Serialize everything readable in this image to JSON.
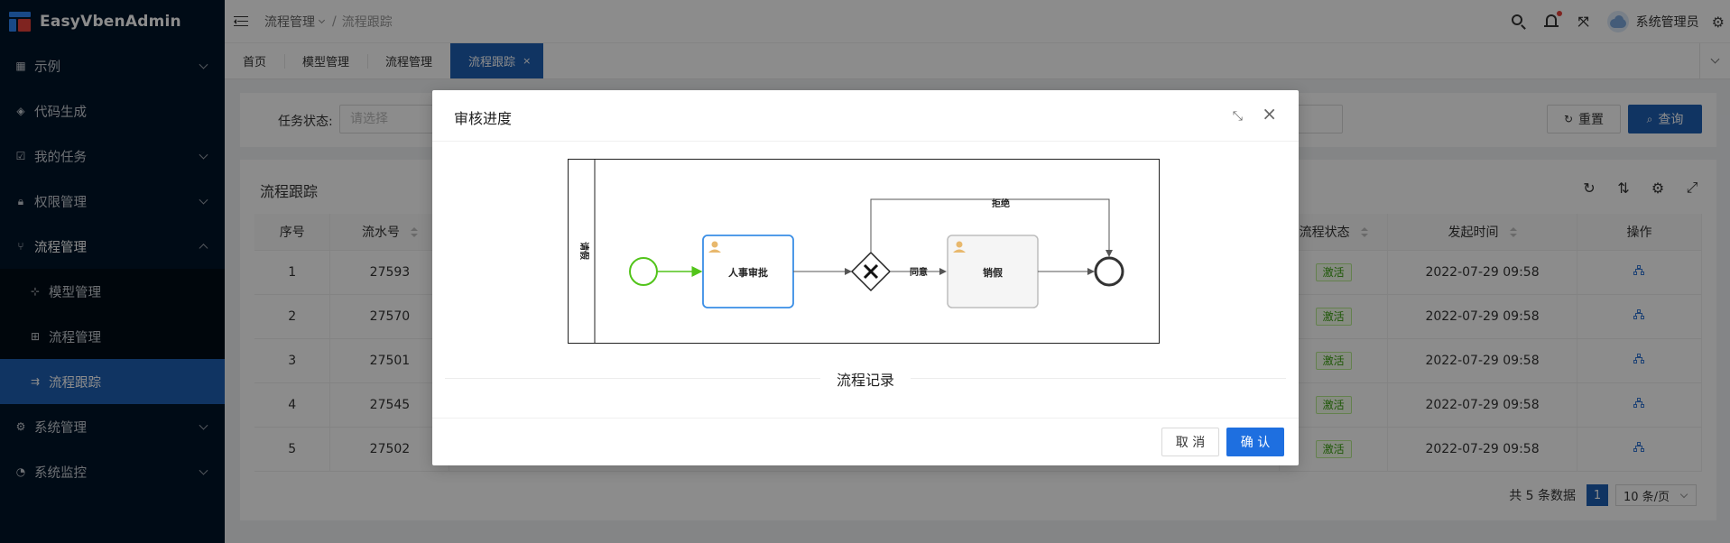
{
  "app": {
    "title": "EasyVbenAdmin"
  },
  "sidebar": {
    "items": [
      {
        "label": "示例",
        "icon": "grid-icon"
      },
      {
        "label": "代码生成",
        "icon": "cube-icon"
      },
      {
        "label": "我的任务",
        "icon": "checkbox-icon"
      },
      {
        "label": "权限管理",
        "icon": "lock-icon"
      },
      {
        "label": "流程管理",
        "icon": "branch-icon"
      },
      {
        "label": "系统管理",
        "icon": "gear-icon"
      },
      {
        "label": "系统监控",
        "icon": "dashboard-icon"
      }
    ],
    "sub_items": [
      {
        "label": "模型管理",
        "icon": "flow-icon"
      },
      {
        "label": "流程管理",
        "icon": "hierarchy-icon"
      },
      {
        "label": "流程跟踪",
        "icon": "track-icon"
      }
    ]
  },
  "header": {
    "breadcrumb": [
      "流程管理",
      "流程跟踪"
    ],
    "breadcrumb_sep": "/",
    "username": "系统管理员"
  },
  "tabs": [
    {
      "label": "首页"
    },
    {
      "label": "模型管理"
    },
    {
      "label": "流程管理"
    },
    {
      "label": "流程跟踪",
      "close": "×"
    }
  ],
  "search": {
    "label": "任务状态:",
    "placeholder": "请选择",
    "reset_label": "重置",
    "query_label": "查询"
  },
  "table": {
    "title": "流程跟踪",
    "columns": [
      "序号",
      "流水号",
      "流程状态",
      "发起时间",
      "操作"
    ],
    "rows": [
      {
        "index": "1",
        "serial": "27593",
        "status": "激活",
        "time": "2022-07-29 09:58"
      },
      {
        "index": "2",
        "serial": "27570",
        "status": "激活",
        "time": "2022-07-29 09:58"
      },
      {
        "index": "3",
        "serial": "27501",
        "status": "激活",
        "time": "2022-07-29 09:58"
      },
      {
        "index": "4",
        "serial": "27545",
        "status": "激活",
        "time": "2022-07-29 09:58"
      },
      {
        "index": "5",
        "serial": "27502",
        "status": "激活",
        "time": "2022-07-29 09:58"
      }
    ]
  },
  "pagination": {
    "total_text": "共 5 条数据",
    "current_page": "1",
    "page_size": "10 条/页"
  },
  "modal": {
    "title": "审核进度",
    "diagram": {
      "lane_label": "请假",
      "task1": "人事审批",
      "task2": "销假",
      "flow_reject": "拒绝",
      "flow_agree": "同意"
    },
    "record_title": "流程记录",
    "cancel_label": "取 消",
    "ok_label": "确 认"
  },
  "colors": {
    "sidebar_bg": "#001529",
    "primary": "#1e5fb3",
    "accent_red": "#e8423b",
    "success_tag": "#389e0d"
  }
}
